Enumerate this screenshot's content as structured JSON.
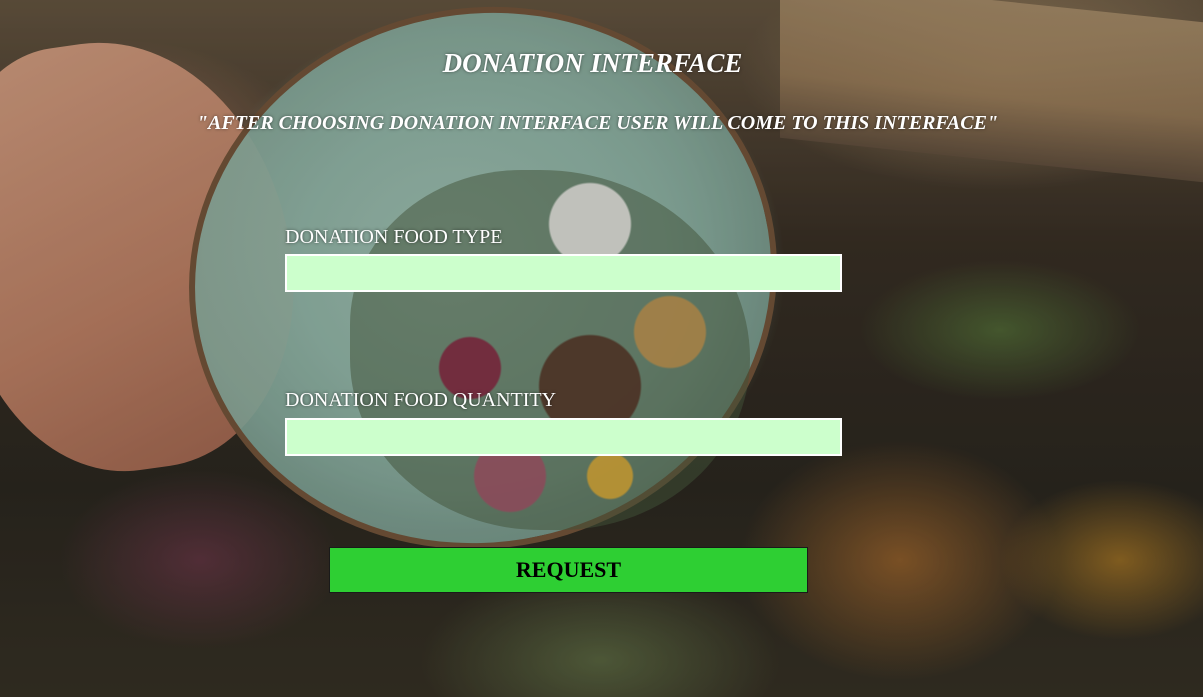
{
  "header": {
    "title": "DONATION INTERFACE",
    "subtitle": "\"AFTER CHOOSING DONATION INTERFACE USER WILL COME TO THIS INTERFACE\""
  },
  "form": {
    "food_type": {
      "label": "DONATION FOOD TYPE",
      "value": "",
      "placeholder": ""
    },
    "food_quantity": {
      "label": "DONATION FOOD QUANTITY",
      "value": "",
      "placeholder": ""
    },
    "submit_label": "REQUEST"
  },
  "colors": {
    "input_background": "#ccffcc",
    "button_background": "#2ecf33",
    "heading_text": "#ffffff"
  }
}
